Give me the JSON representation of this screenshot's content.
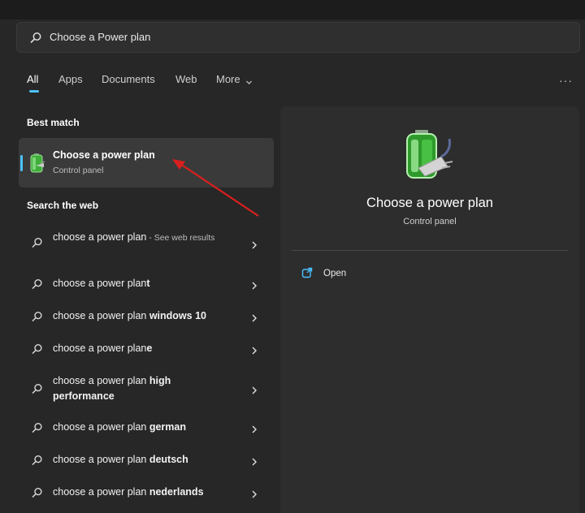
{
  "search": {
    "query": "Choose a Power plan",
    "icon": "search-icon"
  },
  "tabs": [
    {
      "label": "All",
      "active": true
    },
    {
      "label": "Apps"
    },
    {
      "label": "Documents"
    },
    {
      "label": "Web"
    },
    {
      "label": "More"
    }
  ],
  "more_options_icon": "···",
  "best_match": {
    "section_label": "Best match",
    "title": "Choose a power plan",
    "subtitle": "Control panel",
    "icon": "battery-plug-icon"
  },
  "web": {
    "section_label": "Search the web",
    "items": [
      {
        "prefix": "choose a power plan",
        "bold": "",
        "suffix": " - See web results"
      },
      {
        "prefix": "choose a power plan",
        "bold": "t",
        "suffix": ""
      },
      {
        "prefix": "choose a power plan",
        "bold": " windows 10",
        "suffix": ""
      },
      {
        "prefix": "choose a power plan",
        "bold": "e",
        "suffix": ""
      },
      {
        "prefix": "choose a power plan",
        "bold": " high performance",
        "suffix": ""
      },
      {
        "prefix": "choose a power plan",
        "bold": " german",
        "suffix": ""
      },
      {
        "prefix": "choose a power plan",
        "bold": " deutsch",
        "suffix": ""
      },
      {
        "prefix": "choose a power plan",
        "bold": " nederlands",
        "suffix": ""
      }
    ]
  },
  "preview": {
    "title": "Choose a power plan",
    "subtitle": "Control panel",
    "actions": [
      {
        "label": "Open",
        "icon": "open-external-icon"
      }
    ]
  },
  "colors": {
    "accent": "#4cc2ff",
    "annotation": "#d8201e"
  }
}
